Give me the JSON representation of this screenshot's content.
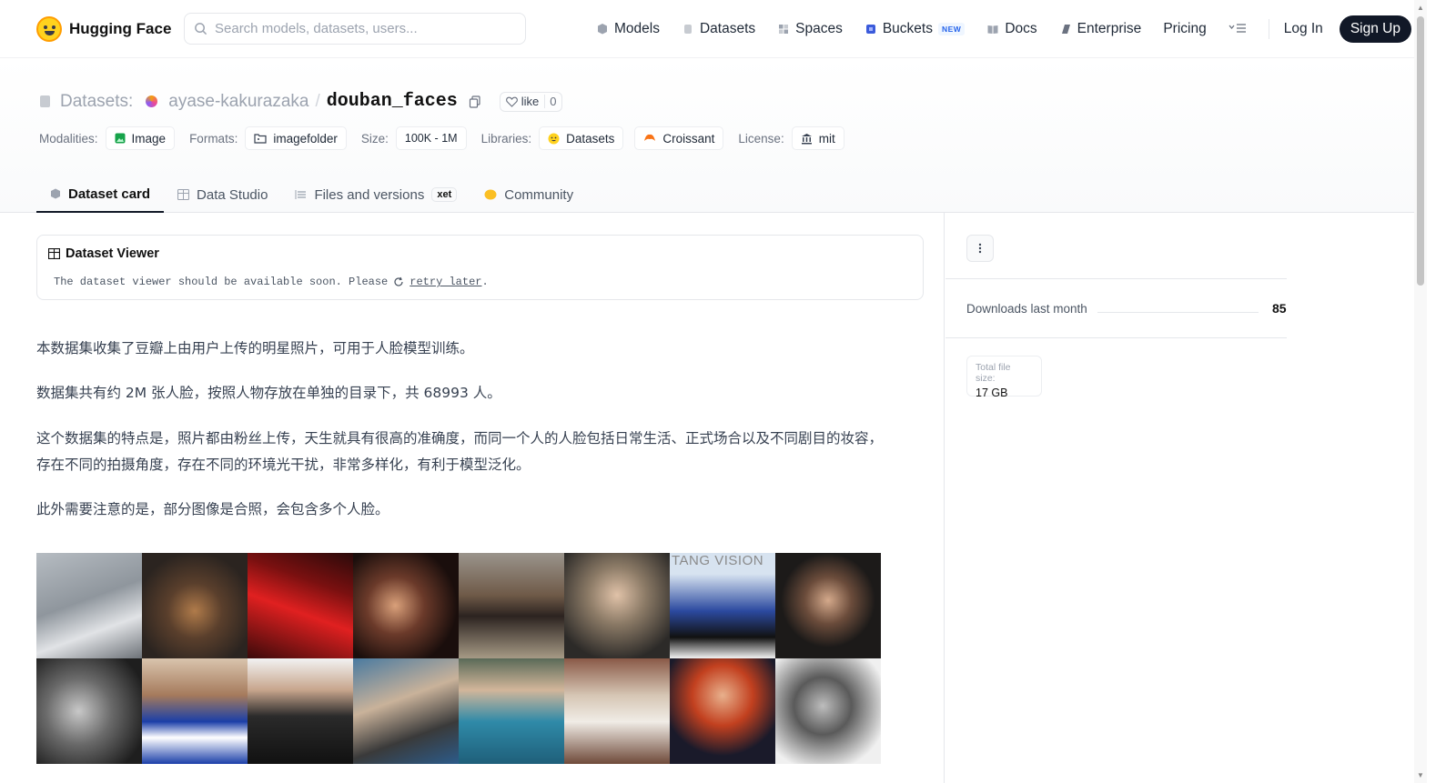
{
  "nav": {
    "brand": "Hugging Face",
    "search_placeholder": "Search models, datasets, users...",
    "links": {
      "models": "Models",
      "datasets": "Datasets",
      "spaces": "Spaces",
      "buckets": "Buckets",
      "buckets_badge": "NEW",
      "docs": "Docs",
      "enterprise": "Enterprise",
      "pricing": "Pricing"
    },
    "login": "Log In",
    "signup": "Sign Up"
  },
  "header": {
    "section_label": "Datasets:",
    "owner": "ayase-kakurazaka",
    "repo": "douban_faces",
    "like_label": "like",
    "like_count": "0",
    "tags": {
      "modalities_label": "Modalities:",
      "modality": "Image",
      "formats_label": "Formats:",
      "format": "imagefolder",
      "size_label": "Size:",
      "size": "100K - 1M",
      "libraries_label": "Libraries:",
      "library_1": "Datasets",
      "library_2": "Croissant",
      "license_label": "License:",
      "license": "mit"
    },
    "tabs": {
      "dataset_card": "Dataset card",
      "data_studio": "Data Studio",
      "files": "Files and versions",
      "files_badge": "xet",
      "community": "Community"
    }
  },
  "viewer": {
    "title": "Dataset Viewer",
    "message": "The dataset viewer should be available soon. Please",
    "retry": "retry later",
    "period": "."
  },
  "card": {
    "p1": "本数据集收集了豆瓣上由用户上传的明星照片，可用于人脸模型训练。",
    "p2": "数据集共有约 2M 张人脸，按照人物存放在单独的目录下，共 68993 人。",
    "p3": "这个数据集的特点是，照片都由粉丝上传，天生就具有很高的准确度，而同一个人的人脸包括日常生活、正式场合以及不同剧目的妆容，存在不同的拍摄角度，存在不同的环境光干扰，非常多样化，有利于模型泛化。",
    "p4": "此外需要注意的是，部分图像是合照，会包含多个人脸。",
    "thumb_text": "TANG VISION"
  },
  "sidebar": {
    "downloads_label": "Downloads last month",
    "downloads_value": "85",
    "filesize_label": "Total file size:",
    "filesize_value": "17 GB"
  }
}
